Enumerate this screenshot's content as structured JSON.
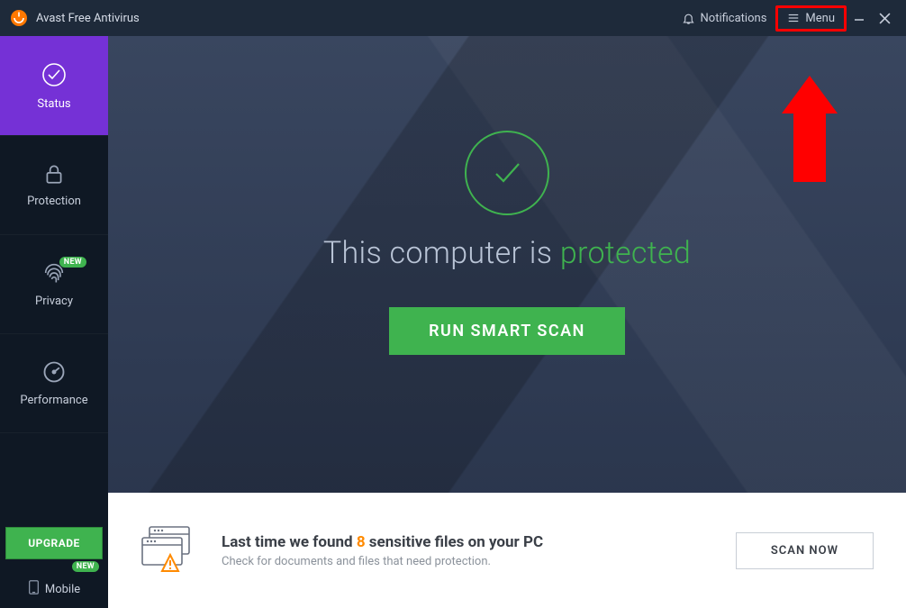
{
  "titlebar": {
    "app_name": "Avast Free Antivirus",
    "notifications_label": "Notifications",
    "menu_label": "Menu"
  },
  "sidebar": {
    "items": [
      {
        "label": "Status"
      },
      {
        "label": "Protection"
      },
      {
        "label": "Privacy",
        "badge": "NEW"
      },
      {
        "label": "Performance"
      }
    ],
    "upgrade_label": "UPGRADE",
    "mobile_label": "Mobile",
    "mobile_badge": "NEW"
  },
  "status": {
    "prefix": "This computer is ",
    "state_word": "protected",
    "smart_scan_label": "RUN SMART SCAN"
  },
  "promo": {
    "title_pre": "Last time we found ",
    "count": "8",
    "title_post": " sensitive files on your PC",
    "subtitle": "Check for documents and files that need protection.",
    "scan_now_label": "SCAN NOW"
  },
  "colors": {
    "accent_green": "#3fb34f",
    "accent_purple": "#7531d6",
    "highlight_red": "#ff0000",
    "count_orange": "#ff8a00"
  }
}
